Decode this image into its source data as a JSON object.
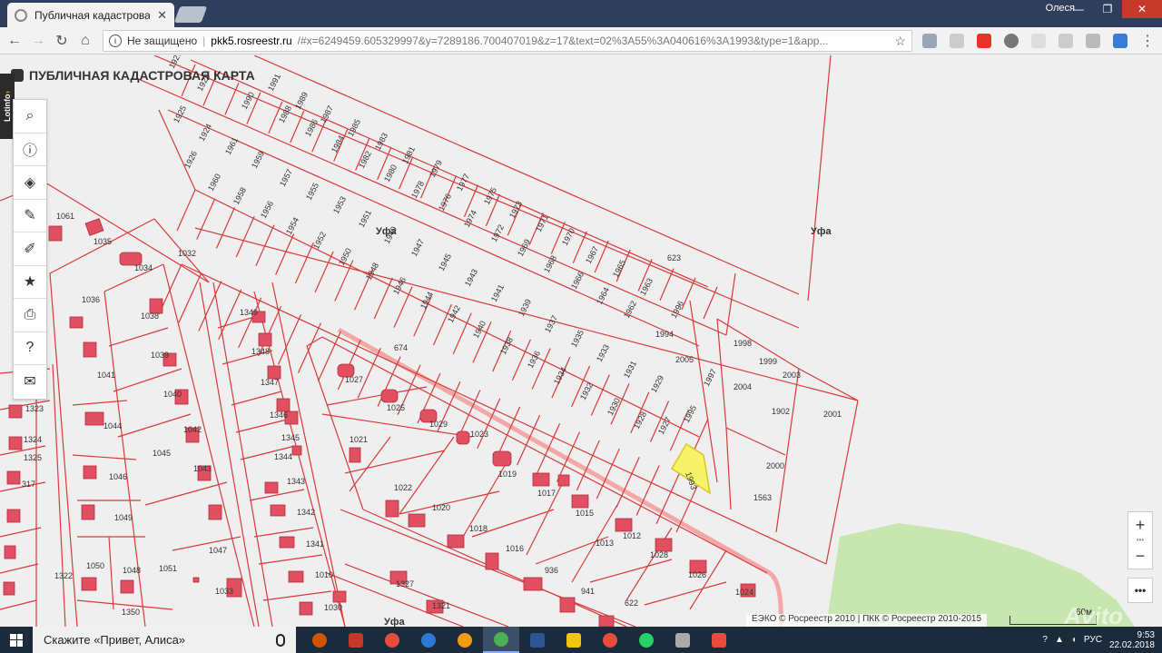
{
  "browser": {
    "tab_title": "Публичная кадастровая",
    "user_name": "Олеся",
    "security_label": "Не защищено",
    "url_host": "pkk5.rosreestr.ru",
    "url_path": "/#x=6249459.605329997&y=7289186.700407019&z=17&text=02%3A55%3A040616%3A1993&type=1&app..."
  },
  "map": {
    "header_title": "ПУБЛИЧНАЯ КАДАСТРОВАЯ КАРТА",
    "lotinfo_label": "Lotinfo",
    "city_labels": [
      "Уфа",
      "Уфа",
      "Уфа"
    ],
    "highlighted_parcel": "1993",
    "parcel_labels": [
      "1921",
      "1923",
      "1991",
      "1989",
      "1987",
      "1985",
      "1983",
      "1981",
      "1979",
      "1977",
      "1975",
      "1973",
      "1971",
      "1970",
      "1967",
      "1965",
      "1963",
      "1996",
      "1925",
      "1924",
      "1961",
      "1959",
      "1957",
      "1955",
      "1953",
      "1951",
      "1949",
      "1947",
      "1945",
      "1943",
      "1941",
      "1939",
      "1937",
      "1935",
      "1933",
      "1931",
      "1929",
      "1926",
      "1960",
      "1958",
      "1956",
      "1954",
      "1952",
      "1950",
      "1948",
      "1946",
      "1944",
      "1942",
      "1940",
      "1938",
      "1936",
      "1934",
      "1932",
      "1930",
      "1928",
      "1927",
      "1995",
      "1990",
      "1988",
      "1986",
      "1984",
      "1982",
      "1980",
      "1978",
      "1976",
      "1974",
      "1972",
      "1969",
      "1968",
      "1966",
      "1964",
      "1962",
      "1994",
      "2005",
      "1997",
      "1998",
      "1999",
      "2003",
      "2004",
      "1902",
      "2001",
      "2000",
      "1563",
      "623",
      "674",
      "1032",
      "1061",
      "1035",
      "1034",
      "1036",
      "1038",
      "1039",
      "1040",
      "1041",
      "1044",
      "1045",
      "1046",
      "1042",
      "1043",
      "1049",
      "1047",
      "1050",
      "1048",
      "1051",
      "1033",
      "1350",
      "1349",
      "1348",
      "1347",
      "1346",
      "1345",
      "1344",
      "1343",
      "1342",
      "1341",
      "1010",
      "1030",
      "1027",
      "1025",
      "1029",
      "1023",
      "1021",
      "1019",
      "1017",
      "1015",
      "1013",
      "1012",
      "1028",
      "1026",
      "1024",
      "1022",
      "1020",
      "1018",
      "1016",
      "936",
      "941",
      "622",
      "1327",
      "1321",
      "1322",
      "1323",
      "1324",
      "1325",
      "317"
    ],
    "tool_icons": [
      "search-icon",
      "info-icon",
      "layers-icon",
      "pencil-icon",
      "measure-icon",
      "star-icon",
      "print-icon",
      "help-icon",
      "mail-icon"
    ],
    "zoom_in": "+",
    "zoom_dots": "•••",
    "zoom_out": "−",
    "more_label": "•••",
    "attribution": "ЕЭКО © Росреестр 2010 | ПКК © Росреестр 2010-2015",
    "scale_label": "60м",
    "watermark": "Avito",
    "colors": {
      "parcel_line": "#d83a3a",
      "building_fill": "#e05060",
      "highlight": "#f7f26a",
      "greenery": "#c8e6b0"
    }
  },
  "taskbar": {
    "search_text": "Скажите «Привет, Алиса»",
    "lang": "РУС",
    "time": "9:53",
    "date": "22.02.2018"
  }
}
